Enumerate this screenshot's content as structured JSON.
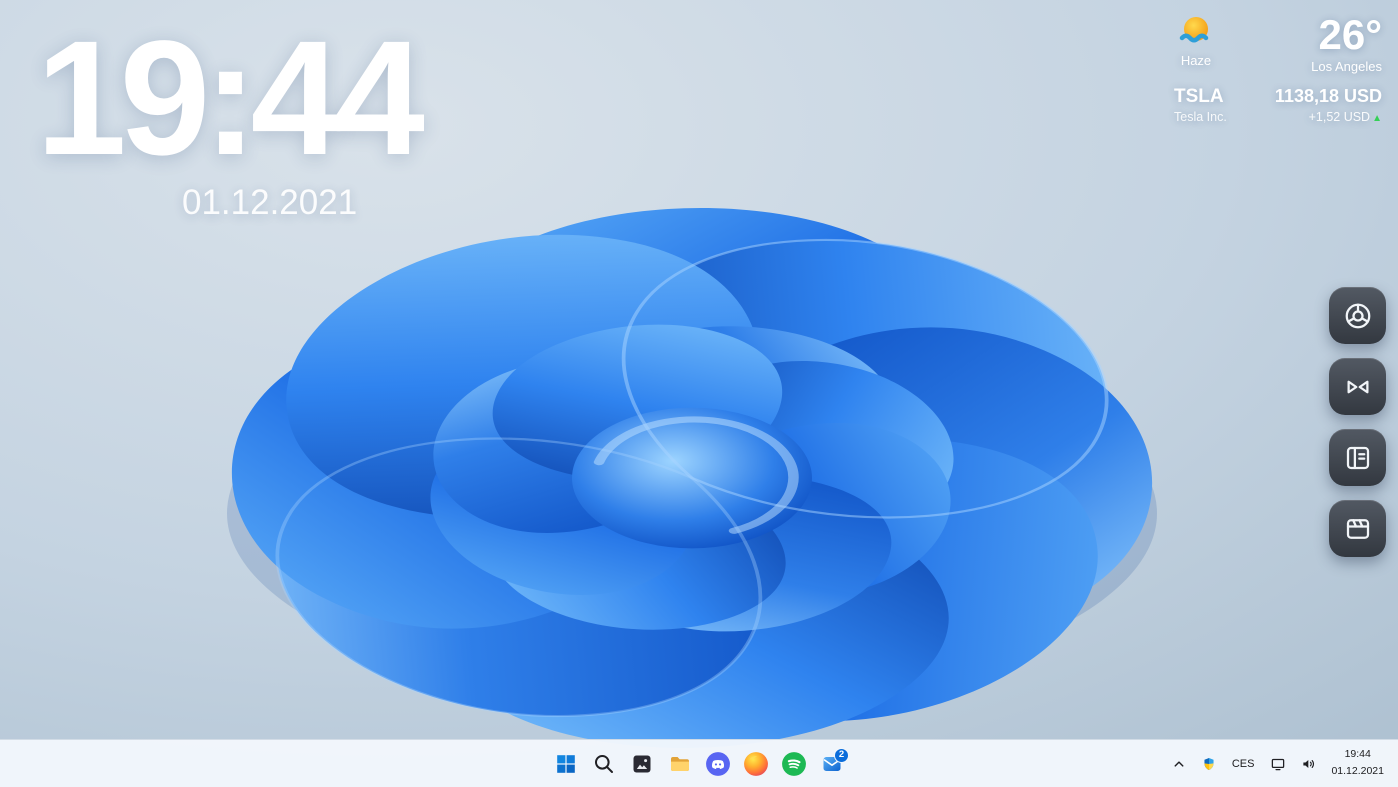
{
  "clock_widget": {
    "time": "19:44",
    "date": "01.12.2021"
  },
  "weather_widget": {
    "icon": "sun-haze-icon",
    "temperature": "26°",
    "condition": "Haze",
    "location": "Los Angeles"
  },
  "stock_widget": {
    "symbol": "TSLA",
    "company": "Tesla Inc.",
    "price": "1138,18 USD",
    "change": "+1,52 USD",
    "change_direction": "up",
    "up_arrow": "▲"
  },
  "dock": {
    "items": [
      {
        "id": "chrome",
        "icon": "chrome-icon"
      },
      {
        "id": "visual-studio",
        "icon": "visual-studio-icon"
      },
      {
        "id": "journal",
        "icon": "journal-icon"
      },
      {
        "id": "media",
        "icon": "clapperboard-icon"
      }
    ]
  },
  "taskbar": {
    "badge_count": "2",
    "items": [
      {
        "id": "start",
        "icon": "windows-start-icon"
      },
      {
        "id": "search",
        "icon": "search-icon"
      },
      {
        "id": "photos",
        "icon": "photos-icon"
      },
      {
        "id": "file-explorer",
        "icon": "folder-icon"
      },
      {
        "id": "discord",
        "icon": "discord-icon"
      },
      {
        "id": "firefox",
        "icon": "firefox-icon"
      },
      {
        "id": "spotify",
        "icon": "spotify-icon"
      },
      {
        "id": "mail",
        "icon": "mail-icon"
      }
    ],
    "tray": {
      "language": "CES",
      "time": "19:44",
      "date": "01.12.2021"
    }
  },
  "colors": {
    "accent_blue": "#0d7dd9",
    "bloom_blue": "#1a6ae4",
    "stock_up_green": "#35d057",
    "taskbar_bg": "#f3f7fc",
    "dock_bg": "#2b2f36"
  }
}
